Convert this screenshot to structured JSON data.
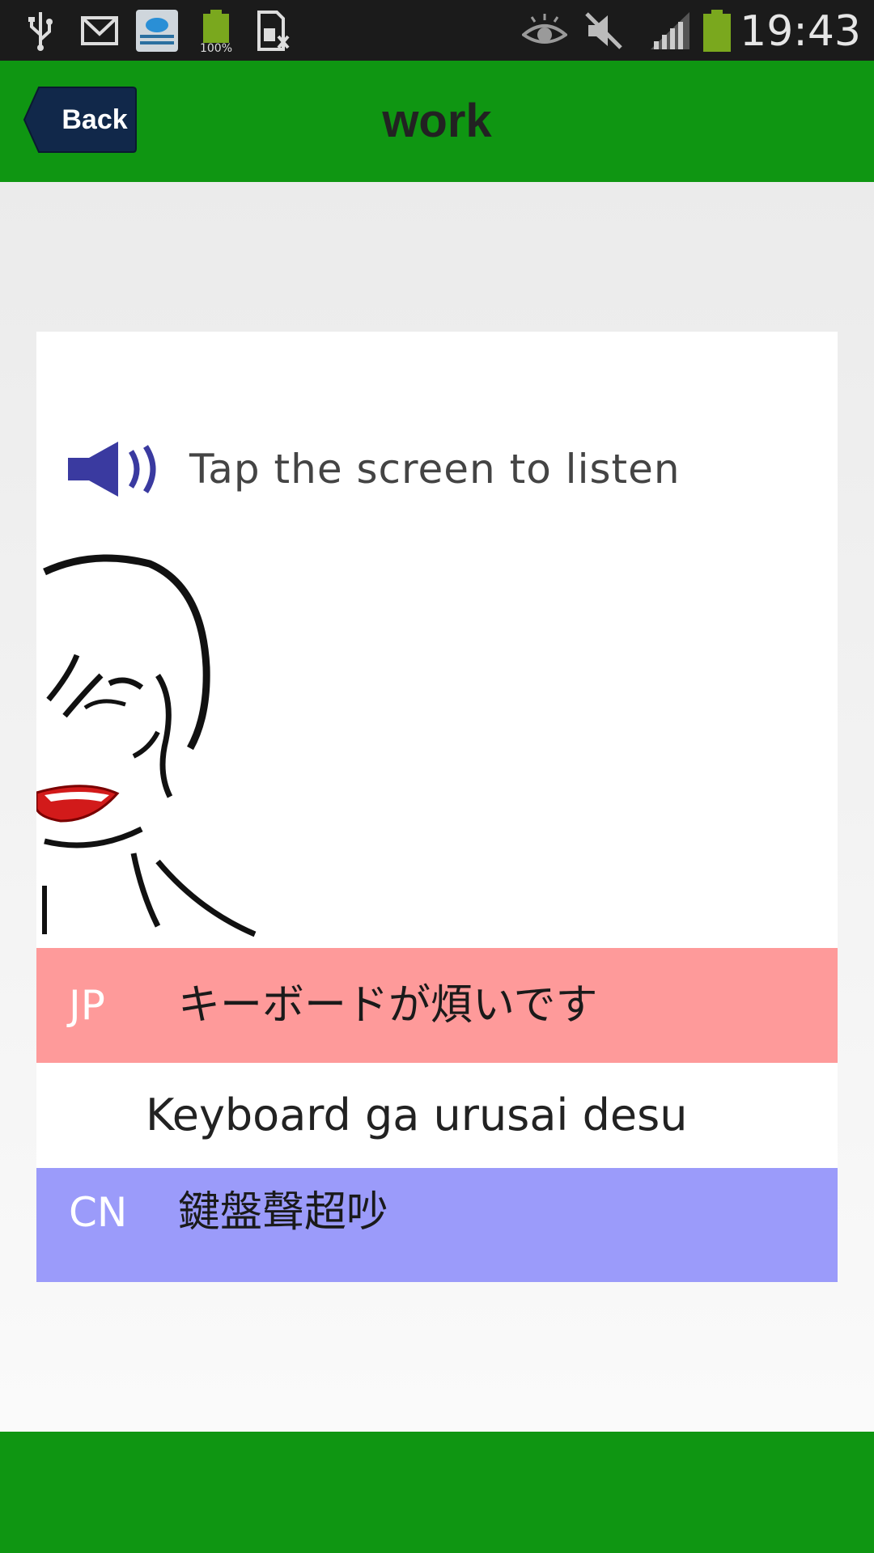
{
  "status_bar": {
    "time": "19:43",
    "battery_small_label": "100%",
    "icons": [
      "usb-icon",
      "gmail-icon",
      "cloud-testing-icon",
      "battery-full-icon",
      "sim-missing-icon",
      "eye-icon",
      "mute-icon",
      "signal-icon",
      "battery-icon"
    ]
  },
  "header": {
    "back_label": "Back",
    "title": "work",
    "color": "#0f9612"
  },
  "card": {
    "listen_label": "Tap the screen to listen",
    "rows": {
      "jp": {
        "code": "JP",
        "text": "キーボードが煩いです",
        "color": "#fe9a9a"
      },
      "romaji": {
        "text": "Keyboard ga urusai desu"
      },
      "cn": {
        "code": "CN",
        "text": "鍵盤聲超吵",
        "color": "#9b9bfa"
      }
    }
  }
}
